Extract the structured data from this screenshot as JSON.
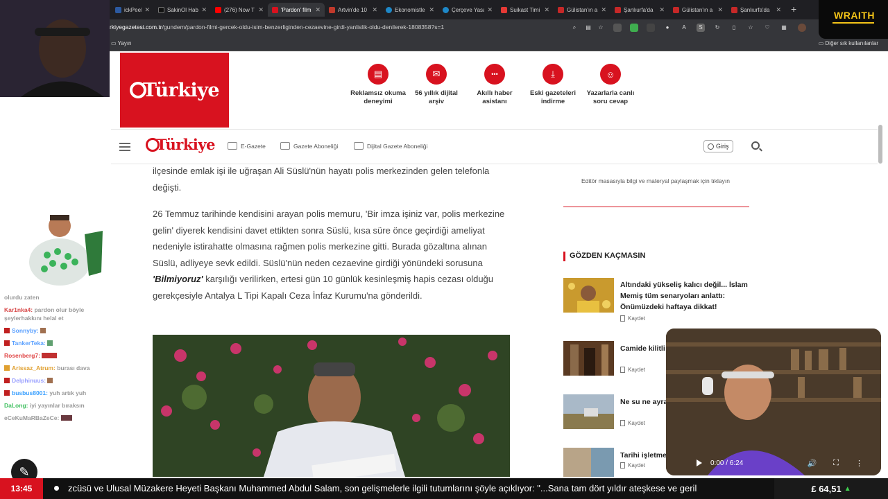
{
  "browser": {
    "tabs": [
      {
        "label": "ickPeek - R",
        "color": "#2c5aa0"
      },
      {
        "label": "SakinOl Hab",
        "color": "#111111"
      },
      {
        "label": "(276) Now T",
        "color": "#ff0000"
      },
      {
        "label": "'Pardon' film",
        "color": "#d8121f",
        "active": true
      },
      {
        "label": "Artvin'de 10",
        "color": "#c0392b"
      },
      {
        "label": "Ekonomistle",
        "color": "#1e88c8"
      },
      {
        "label": "Çerçeve Yasa",
        "color": "#1e88c8"
      },
      {
        "label": "Suikast Timi",
        "color": "#e53935"
      },
      {
        "label": "Gülistan'ın a",
        "color": "#c62828"
      },
      {
        "label": "Şanlıurfa'da",
        "color": "#c62828"
      },
      {
        "label": "Gülistan'ın a",
        "color": "#c62828"
      },
      {
        "label": "Şanlıurfa'da",
        "color": "#c62828"
      }
    ],
    "new_tab_icon": "plus-icon",
    "url_host": "rkiyegazetesi.com.tr",
    "url_path": "/gundem/pardon-filmi-gercek-oldu-isim-benzerliginden-cezaevine-girdi-yanlislik-oldu-denilerek-1808358?s=1",
    "bookmark_left": "Yayın",
    "bookmark_right": "Diğer sık kullanılanlar"
  },
  "site": {
    "logo": "Türkiye",
    "brand_color": "#d8121f",
    "features": [
      {
        "icon": "newspaper-icon",
        "glyph": "▤",
        "label": "Reklamsız okuma deneyimi"
      },
      {
        "icon": "mail-icon",
        "glyph": "✉",
        "label": "56 yıllık dijital arşiv"
      },
      {
        "icon": "chat-icon",
        "glyph": "•••",
        "label": "Akıllı haber asistanı"
      },
      {
        "icon": "download-icon",
        "glyph": "⤓",
        "label": "Eski gazeteleri indirme"
      },
      {
        "icon": "users-icon",
        "glyph": "☺",
        "label": "Yazarlarla canlı soru cevap"
      }
    ],
    "nav": {
      "links": [
        "E-Gazete",
        "Gazete Aboneliği",
        "Dijital Gazete Aboneliği"
      ],
      "login": "Giriş"
    }
  },
  "article": {
    "p1": "ilçesinde emlak işi ile uğraşan Ali Süslü'nün hayatı polis merkezinden gelen telefonla değişti.",
    "p2_before": "26 Temmuz tarihinde kendisini arayan polis memuru, 'Bir imza işiniz var, polis merkezine gelin' diyerek kendisini davet ettikten sonra Süslü, kısa süre önce geçirdiği ameliyat nedeniyle istirahatte olmasına rağmen polis merkezine gitti. Burada gözaltına alınan Süslü, adliyeye sevk edildi. Süslü'nün neden cezaevine girdiği yönündeki sorusuna ",
    "p2_bold": "'Bilmiyoruz'",
    "p2_after": " karşılığı verilirken, ertesi gün 10 günlük kesinleşmiş hapis cezası olduğu gerekçesiyle Antalya L Tipi Kapalı Ceza İnfaz Kurumu'na gönderildi."
  },
  "sidebar": {
    "editor_note": "Editör masasıyla bilgi ve materyal paylaşmak için tıklayın",
    "section_title": "GÖZDEN KAÇMASIN",
    "save_label": "Kaydet",
    "items": [
      {
        "title": "Altındaki yükseliş kalıcı değil... İslam Memiş tüm senaryoları anlattı: Önümüzdeki haftaya dikkat!"
      },
      {
        "title": "Camide kilitli yardım istedi"
      },
      {
        "title": "Ne su ne ayra çalışan çiftçil"
      },
      {
        "title": "Tarihi işletmeye tol"
      }
    ]
  },
  "stream": {
    "chat": [
      {
        "user": "",
        "text": "olurdu zaten",
        "color": "#9a9a9a"
      },
      {
        "user": "Kar1nka4:",
        "text": " pardon olur böyle şeylerhakkını helal et",
        "color": "#d84a4a"
      },
      {
        "user": "Sonnyby:",
        "text": " ",
        "color": "#5aa0ff"
      },
      {
        "user": "TankerTeka:",
        "text": " ",
        "color": "#5aa0ff"
      },
      {
        "user": "Rosenberg7:",
        "text": " ",
        "color": "#e04848"
      },
      {
        "user": "Arissaz_Atrum:",
        "text": " burası dava",
        "color": "#e0a030"
      },
      {
        "user": "Delphinuus:",
        "text": " ",
        "color": "#e04848"
      },
      {
        "user": "busbus8001:",
        "text": " yuh artık yuh",
        "color": "#3aa0ff"
      },
      {
        "user": "DaLong:",
        "text": " iyi yayınlar bıraksın",
        "color": "#40c060"
      },
      {
        "user": "eCeKuMaRBaZeCe:",
        "text": " ",
        "color": "#9a9a9a"
      }
    ],
    "sponsor": "WRAITH",
    "video_time": "0:00 / 6:24",
    "ticker_time": "13:45",
    "ticker_text": "zcüsü ve Ulusal Müzakere Heyeti Başkanı Muhammed Abdul Salam, son gelişmelerle ilgili tutumlarını şöyle açıklıyor: \"...Sana tam dört yıldır ateşkese ve geril",
    "ticker_price": "£ 64,51"
  }
}
